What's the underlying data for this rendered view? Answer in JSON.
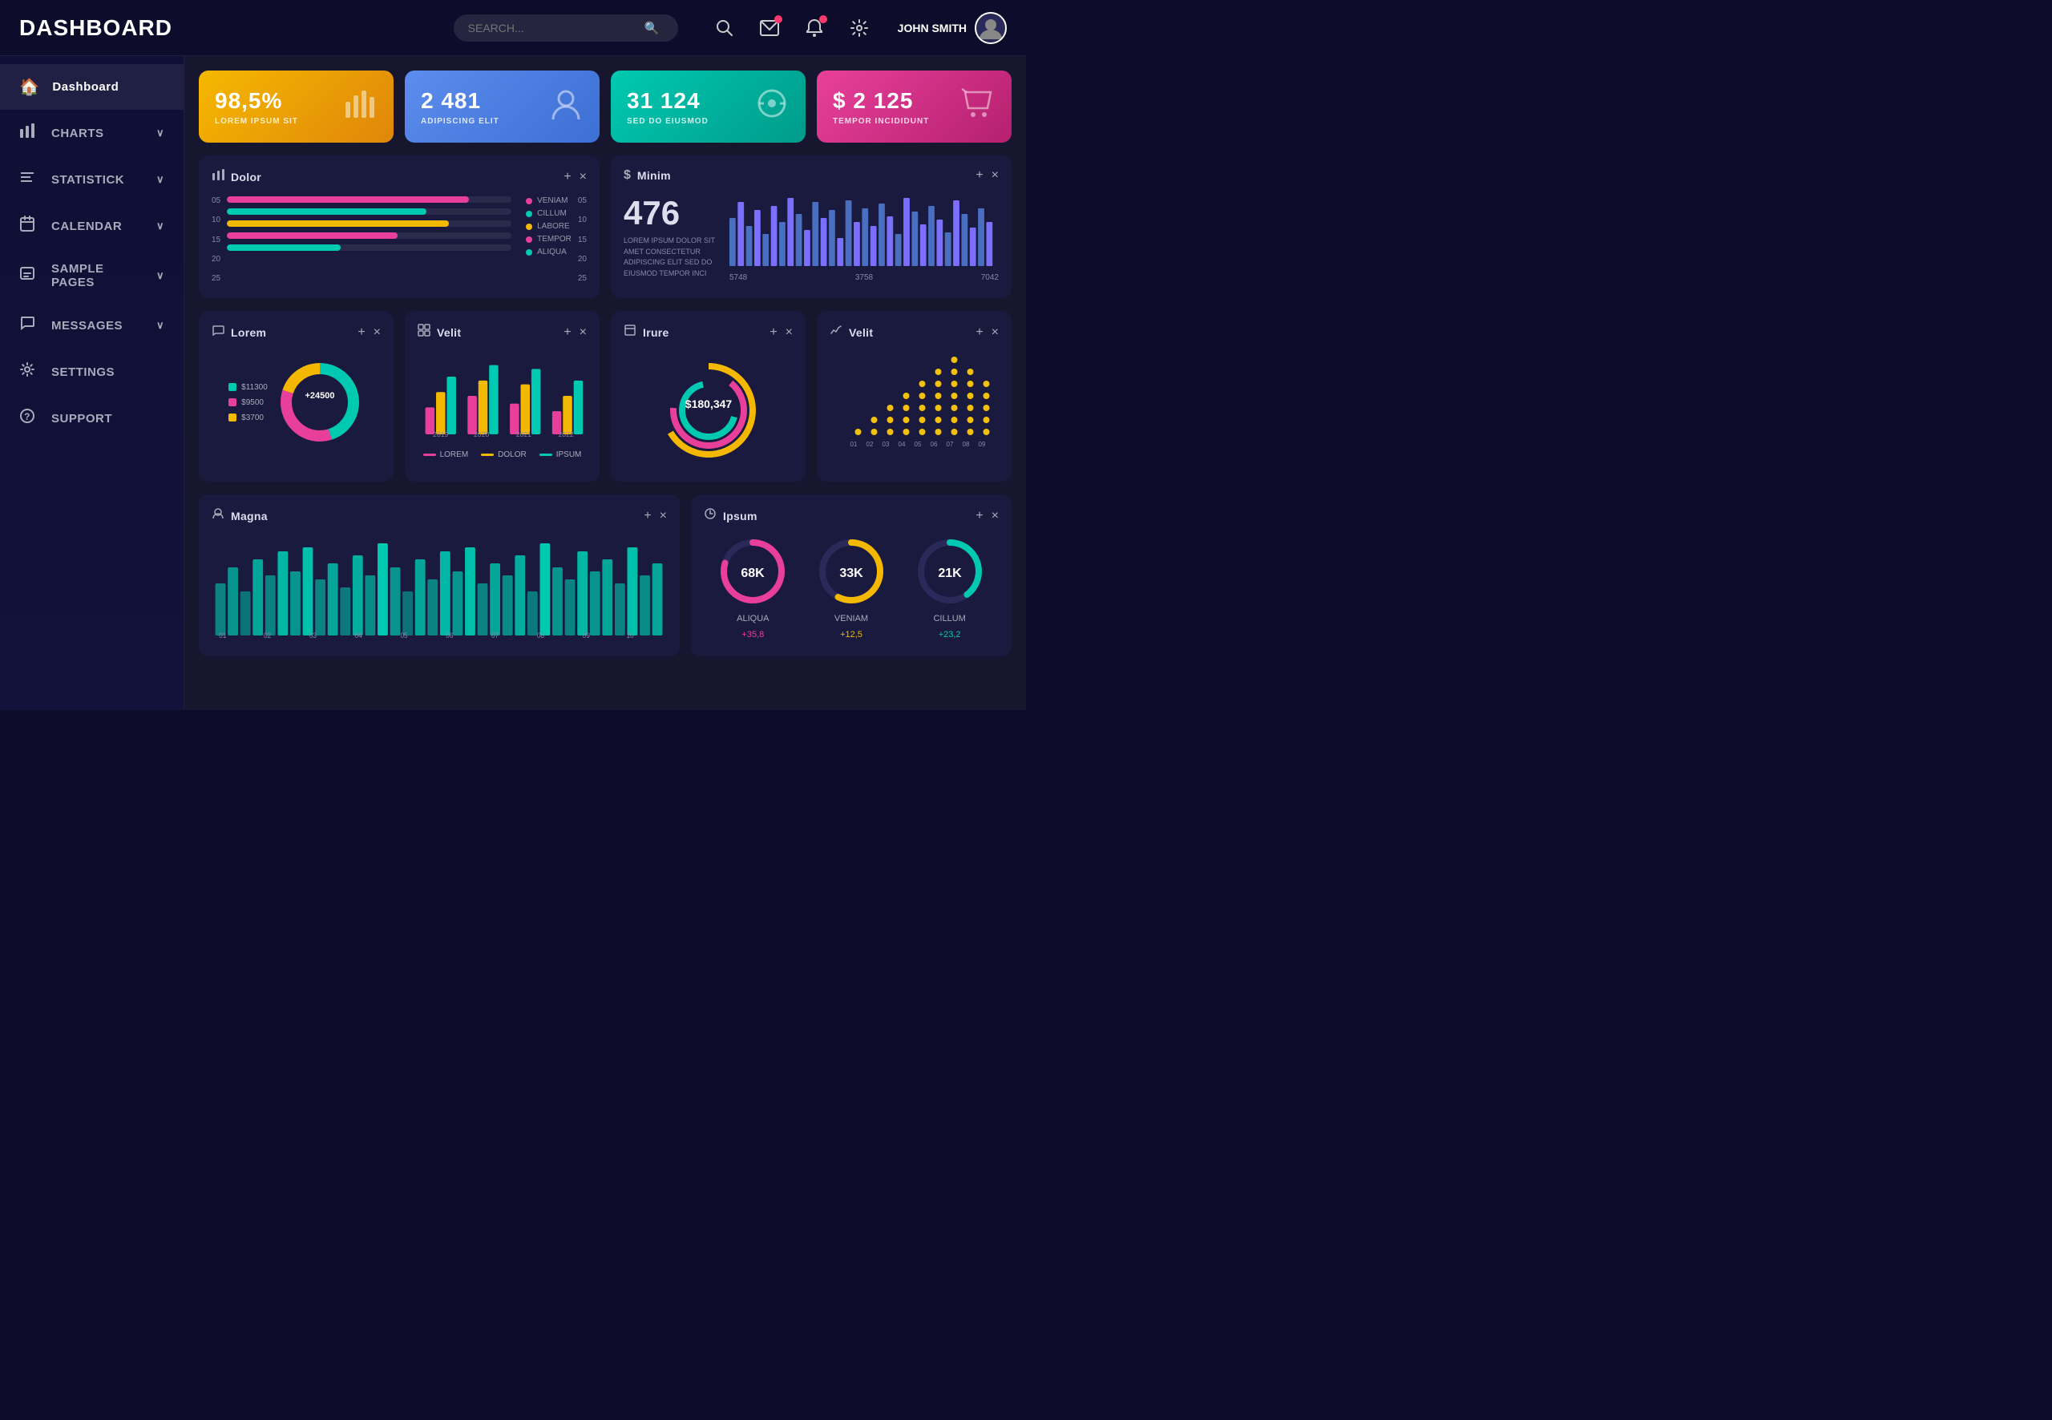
{
  "header": {
    "title": "DASHBOARD",
    "search_placeholder": "SEARCH...",
    "user_name": "JOHN SMITH"
  },
  "sidebar": {
    "items": [
      {
        "id": "dashboard",
        "label": "Dashboard",
        "icon": "🏠",
        "active": true,
        "has_chevron": false
      },
      {
        "id": "charts",
        "label": "CHARTS",
        "icon": "📊",
        "active": false,
        "has_chevron": true
      },
      {
        "id": "statistick",
        "label": "STATISTICK",
        "icon": "📶",
        "active": false,
        "has_chevron": true
      },
      {
        "id": "calendar",
        "label": "CALENDAR",
        "icon": "🗓",
        "active": false,
        "has_chevron": true
      },
      {
        "id": "sample-pages",
        "label": "SAMPLE PAGES",
        "icon": "💬",
        "active": false,
        "has_chevron": true
      },
      {
        "id": "messages",
        "label": "MESSAGES",
        "icon": "🗨",
        "active": false,
        "has_chevron": true
      },
      {
        "id": "settings",
        "label": "SETTINGS",
        "icon": "⚙",
        "active": false,
        "has_chevron": false
      },
      {
        "id": "support",
        "label": "SUPPORT",
        "icon": "❓",
        "active": false,
        "has_chevron": false
      }
    ]
  },
  "stat_cards": [
    {
      "id": "card1",
      "value": "98,5%",
      "label": "LOREM IPSUM SIT",
      "icon": "📊",
      "color": "yellow"
    },
    {
      "id": "card2",
      "value": "2 481",
      "label": "ADIPISCING ELIT",
      "icon": "👤",
      "color": "blue"
    },
    {
      "id": "card3",
      "value": "31 124",
      "label": "SED DO EIUSMOD",
      "icon": "👁",
      "color": "teal"
    },
    {
      "id": "card4",
      "value": "$ 2 125",
      "label": "TEMPOR INCIDIDUNT",
      "icon": "🛒",
      "color": "pink"
    }
  ],
  "panels": {
    "dolor": {
      "title": "Dolor",
      "icon": "📊",
      "bars": [
        {
          "label": "VENIAM",
          "pct": 85,
          "color": "#e8409a"
        },
        {
          "label": "CILLUM",
          "pct": 70,
          "color": "#00c9b1"
        },
        {
          "label": "LABORE",
          "pct": 78,
          "color": "#f5b800"
        },
        {
          "label": "TEMPOR",
          "pct": 60,
          "color": "#e8409a"
        },
        {
          "label": "ALIQUA",
          "pct": 40,
          "color": "#00c9b1"
        }
      ],
      "yaxis": [
        "25",
        "20",
        "15",
        "10",
        "05"
      ],
      "ryaxis": [
        "25",
        "20",
        "15",
        "10",
        "05"
      ]
    },
    "minim": {
      "title": "Minim",
      "icon": "$",
      "number": "476",
      "desc": "LOREM IPSUM DOLOR SIT AMET CONSECTETUR ADIPISCING ELIT SED DO EIUSMOD TEMPOR INCI",
      "xaxis": [
        "5748",
        "3758",
        "7042"
      ]
    },
    "lorem": {
      "title": "Lorem",
      "icon": "💬",
      "segments": [
        {
          "label": "$11300",
          "color": "#00c9b1",
          "value": 45
        },
        {
          "label": "$9500",
          "color": "#e8409a",
          "value": 35
        },
        {
          "label": "$3700",
          "color": "#f5b800",
          "value": 20
        }
      ],
      "center_label": "+24500"
    },
    "velit_bar": {
      "title": "Velit",
      "icon": "⊞",
      "legend": [
        "LOREM",
        "DOLOR",
        "IPSUM"
      ],
      "xaxis": [
        "2019",
        "2020",
        "2021",
        "2022"
      ]
    },
    "irure": {
      "title": "Irure",
      "icon": "📄",
      "center_value": "$180,347",
      "ring_colors": [
        "#f5b800",
        "#e8409a",
        "#00c9b1"
      ]
    },
    "velit_dot": {
      "title": "Velit",
      "icon": "↗",
      "xaxis": [
        "01",
        "02",
        "03",
        "04",
        "05",
        "06",
        "07",
        "08",
        "09"
      ]
    },
    "magna": {
      "title": "Magna",
      "icon": "👤",
      "xaxis": [
        "01",
        "02",
        "03",
        "04",
        "05",
        "06",
        "07",
        "08",
        "09",
        "10"
      ]
    },
    "ipsum": {
      "title": "Ipsum",
      "icon": "🕐",
      "circles": [
        {
          "value": "68K",
          "label": "ALIQUA",
          "change": "+35,8",
          "color": "#e8409a"
        },
        {
          "value": "33K",
          "label": "VENIAM",
          "change": "+12,5",
          "color": "#f5b800"
        },
        {
          "value": "21K",
          "label": "CILLUM",
          "change": "+23,2",
          "color": "#00c9b1"
        }
      ]
    }
  },
  "icons": {
    "search": "🔍",
    "mail": "✉",
    "bell": "🔔",
    "gear": "⚙",
    "plus": "+",
    "close": "×",
    "chevron_down": "∨"
  }
}
